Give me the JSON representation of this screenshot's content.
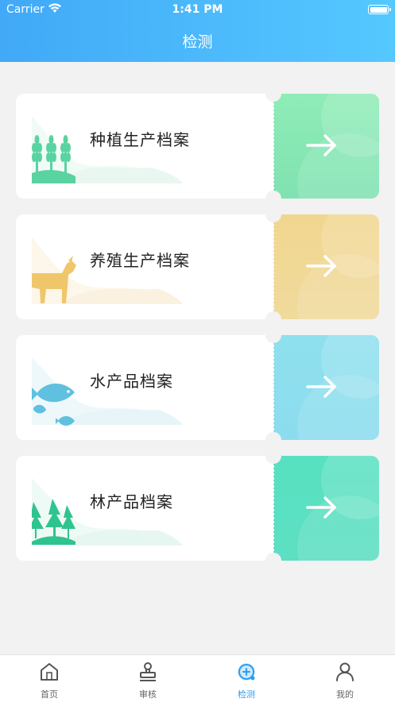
{
  "status_bar": {
    "carrier": "Carrier",
    "time": "1:41 PM"
  },
  "header": {
    "title": "检测"
  },
  "cards": [
    {
      "label": "种植生产档案",
      "color": "#86e8b4",
      "icon": "wheat-icon"
    },
    {
      "label": "养殖生产档案",
      "color": "#f0d796",
      "icon": "goat-icon"
    },
    {
      "label": "水产品档案",
      "color": "#8bdcec",
      "icon": "fish-icon"
    },
    {
      "label": "林产品档案",
      "color": "#57dec0",
      "icon": "tree-icon"
    }
  ],
  "tabbar": {
    "items": [
      {
        "label": "首页",
        "icon": "home-icon",
        "active": false
      },
      {
        "label": "审核",
        "icon": "stamp-icon",
        "active": false
      },
      {
        "label": "检测",
        "icon": "detect-icon",
        "active": true
      },
      {
        "label": "我的",
        "icon": "user-icon",
        "active": false
      }
    ],
    "active_color": "#2d9df0"
  }
}
